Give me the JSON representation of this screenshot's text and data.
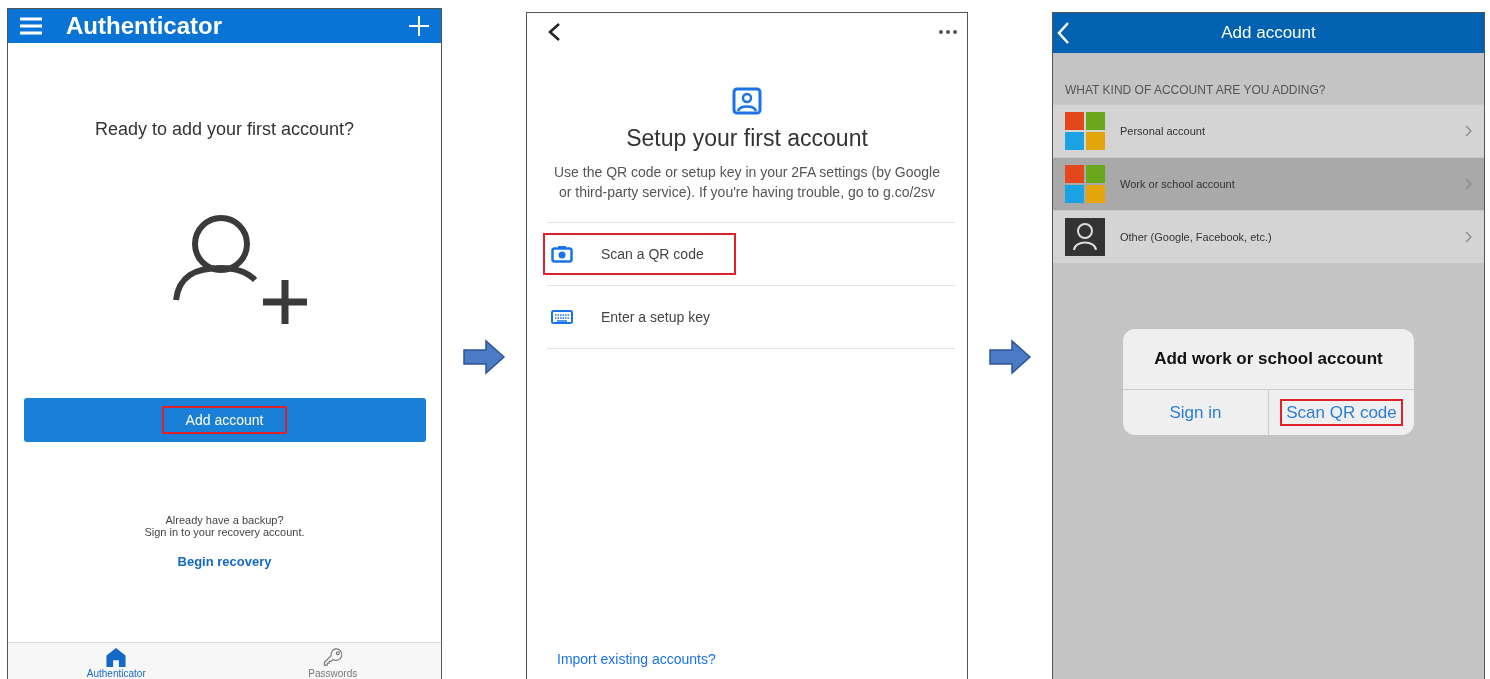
{
  "screens": [
    {
      "kind": "authenticator",
      "header": {
        "title": "Authenticator"
      },
      "prompt": "Ready to add your first account?",
      "add_button": {
        "label": "Add account",
        "highlighted": true
      },
      "backup_text": [
        "Already have a backup?",
        "Sign in to your recovery account."
      ],
      "recovery_link": "Begin recovery",
      "tabs": [
        {
          "label": "Authenticator",
          "kind": "home",
          "selected": true
        },
        {
          "label": "Passwords",
          "kind": "key",
          "selected": false
        }
      ]
    },
    {
      "kind": "google",
      "title": "Setup your first account",
      "description": "Use the QR code or setup key in your 2FA settings (by Google or third-party service). If you're having trouble, go to g.co/2sv",
      "options": [
        {
          "label": "Scan a QR code",
          "kind": "camera",
          "highlighted": true
        },
        {
          "label": "Enter a setup key",
          "kind": "keyboard",
          "highlighted": false
        }
      ],
      "import_link": "Import existing accounts?"
    },
    {
      "kind": "microsoft",
      "header": {
        "title": "Add account"
      },
      "section_label": "WHAT KIND OF ACCOUNT ARE YOU ADDING?",
      "rows": [
        {
          "label": "Personal account",
          "kind": "microsoft",
          "selected": false
        },
        {
          "label": "Work or school account",
          "kind": "microsoft",
          "selected": true
        },
        {
          "label": "Other (Google, Facebook, etc.)",
          "kind": "person",
          "selected": false
        }
      ],
      "dialog": {
        "title": "Add work or school account",
        "buttons": [
          {
            "label": "Sign in",
            "highlighted": false
          },
          {
            "label": "Scan QR code",
            "highlighted": true
          }
        ]
      }
    }
  ]
}
